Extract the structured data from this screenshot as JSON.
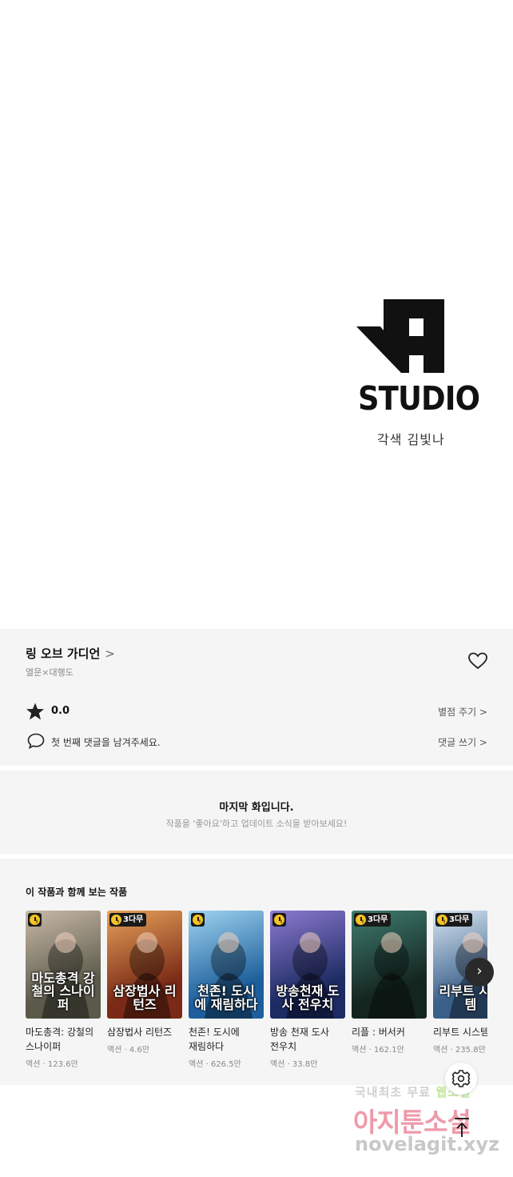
{
  "studio": {
    "wordmark": "STUDIO",
    "credit": "각색 김빛나"
  },
  "series": {
    "title": "링 오브 가디언",
    "title_chevron": ">",
    "author": "열문×대행도"
  },
  "rating": {
    "value": "0.0",
    "rate_label": "별점 주기 >"
  },
  "comment": {
    "prompt": "첫 번째 댓글을 남겨주세요.",
    "write_label": "댓글 쓰기 >"
  },
  "last_episode": {
    "title": "마지막 화입니다.",
    "subtitle": "작품을 '좋아요'하고 업데이트 소식을 받아보세요!"
  },
  "recommendations": {
    "heading": "이 작품과 함께 보는 작품",
    "items": [
      {
        "name": "마도총격: 강철의 스나이퍼",
        "meta": "액션 · 123.6만",
        "badge": "",
        "cover_text": "마도총격 강철의 스나이퍼",
        "colors": [
          "#5b5a4a",
          "#c9b9a8"
        ]
      },
      {
        "name": "삼장법사 리턴즈",
        "meta": "액션 · 4.6만",
        "badge": "3다무",
        "cover_text": "삼장법사 리턴즈",
        "colors": [
          "#7a2a16",
          "#e8a25a"
        ]
      },
      {
        "name": "천존! 도시에 재림하다",
        "meta": "액션 · 626.5만",
        "badge": "",
        "cover_text": "천존! 도시에 재림하다",
        "colors": [
          "#1d5f9c",
          "#9fd4f0"
        ]
      },
      {
        "name": "방송 천재 도사 전우치",
        "meta": "액션 · 33.8만",
        "badge": "",
        "cover_text": "방송천재 도사 전우치",
        "colors": [
          "#1c2b63",
          "#8d7ad1"
        ]
      },
      {
        "name": "리플 : 버서커",
        "meta": "액션 · 162.1만",
        "badge": "3다무",
        "cover_text": "",
        "colors": [
          "#14251f",
          "#3f7c70"
        ]
      },
      {
        "name": "리부트 시스템",
        "meta": "액션 · 235.8만",
        "badge": "3다무",
        "cover_text": "리부트 시스템",
        "colors": [
          "#3a5f8a",
          "#d8e6f2"
        ]
      }
    ]
  },
  "icons": {
    "heart": "heart-outline-icon",
    "star": "star-icon",
    "comment": "speech-bubble-icon",
    "next": "chevron-right-icon",
    "settings": "gear-icon",
    "top": "arrow-up-to-line-icon"
  },
  "watermark": {
    "line1_a": "국내최초 무료 ",
    "line1_b": "웹소설",
    "line2": "아지툰소설",
    "line3": "novelagit.xyz"
  }
}
